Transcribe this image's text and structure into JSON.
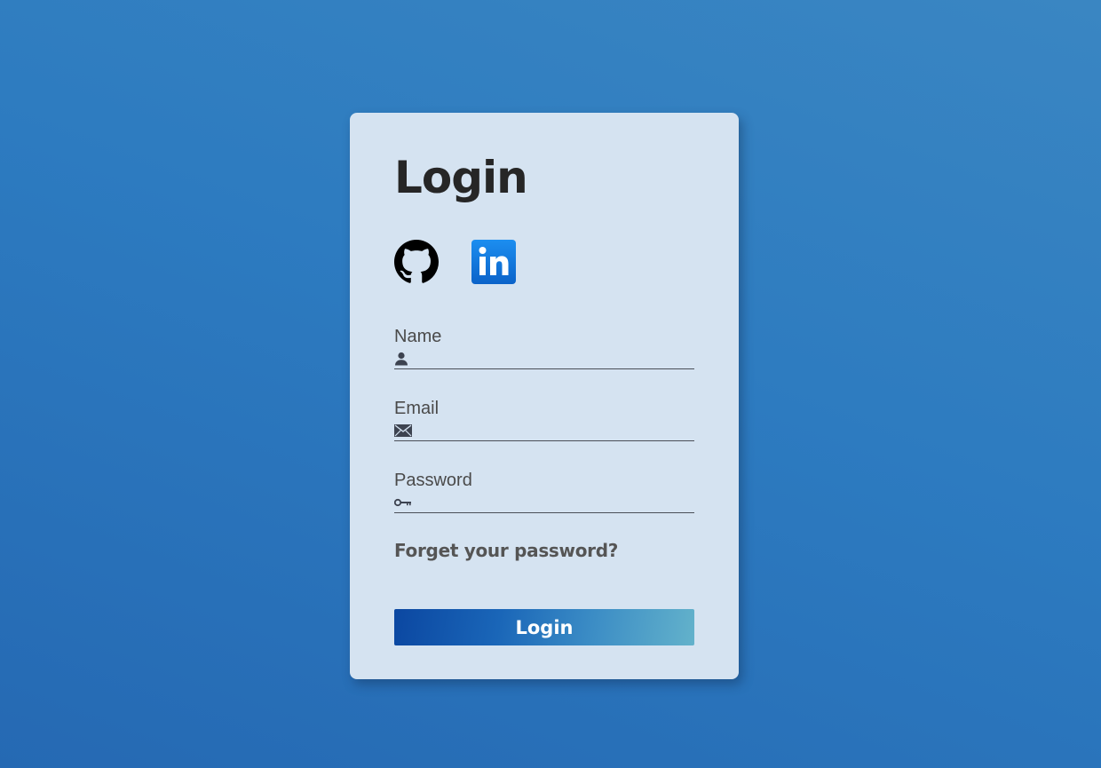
{
  "login_card": {
    "title": "Login",
    "social": [
      {
        "name": "github",
        "icon": "github-icon",
        "color": "#000000"
      },
      {
        "name": "linkedin",
        "icon": "linkedin-icon",
        "color": "#0a66c2"
      }
    ],
    "fields": {
      "name": {
        "label": "Name",
        "icon": "user-icon",
        "value": "",
        "placeholder": ""
      },
      "email": {
        "label": "Email",
        "icon": "envelope-icon",
        "value": "",
        "placeholder": ""
      },
      "password": {
        "label": "Password",
        "icon": "key-icon",
        "value": "",
        "placeholder": ""
      }
    },
    "forgot_link": "Forget your password?",
    "submit_label": "Login"
  },
  "colors": {
    "background": "#2d7bc0",
    "card": "#d5e3f1",
    "button_start": "#0b47a1",
    "button_end": "#63b2cb",
    "text": "#262626"
  }
}
